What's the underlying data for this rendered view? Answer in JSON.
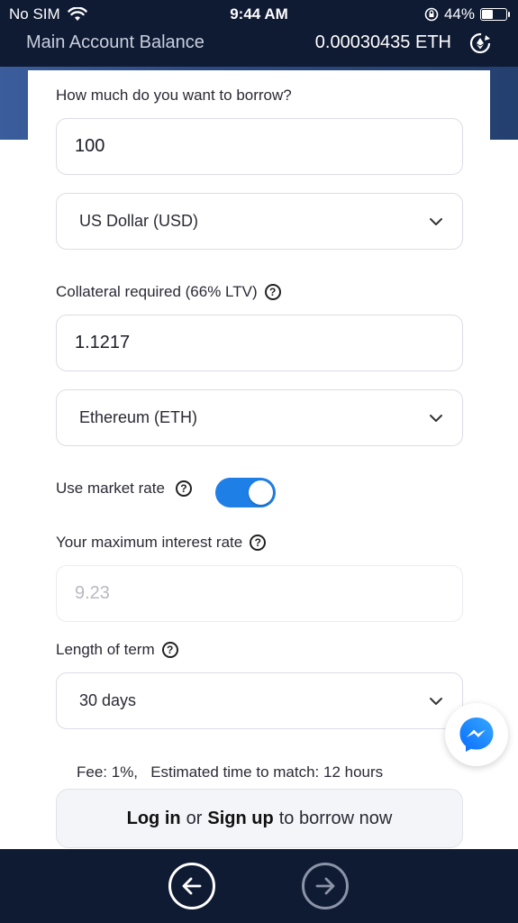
{
  "status_bar": {
    "carrier": "No SIM",
    "time": "9:44 AM",
    "battery": "44%",
    "battery_level": 0.44
  },
  "header": {
    "balance_label": "Main Account Balance",
    "balance_value": "0.00030435 ETH"
  },
  "form": {
    "borrow_label": "How much do you want to borrow?",
    "borrow_amount": "100",
    "borrow_currency": "US Dollar (USD)",
    "collateral_label": "Collateral required (66% LTV)",
    "collateral_amount": "1.1217",
    "collateral_currency": "Ethereum (ETH)",
    "market_rate_label": "Use market rate",
    "market_rate_enabled": true,
    "max_interest_label": "Your maximum interest rate",
    "max_interest_placeholder": "9.23",
    "term_label": "Length of term",
    "term_value": "30 days",
    "fee_text": "Fee: 1%,   Estimated time to match: 12 hours",
    "cta_login": "Log in",
    "cta_or": "or",
    "cta_signup": "Sign up",
    "cta_rest": "to borrow now"
  },
  "colors": {
    "header_bg": "#0f1a33",
    "band": "#2b4a83",
    "accent": "#1e7fe6"
  },
  "icons": {
    "refresh": "refresh-icon",
    "help": "help-icon",
    "chevron": "chevron-down-icon",
    "messenger": "messenger-icon",
    "back": "arrow-left-icon",
    "next": "arrow-right-icon"
  }
}
